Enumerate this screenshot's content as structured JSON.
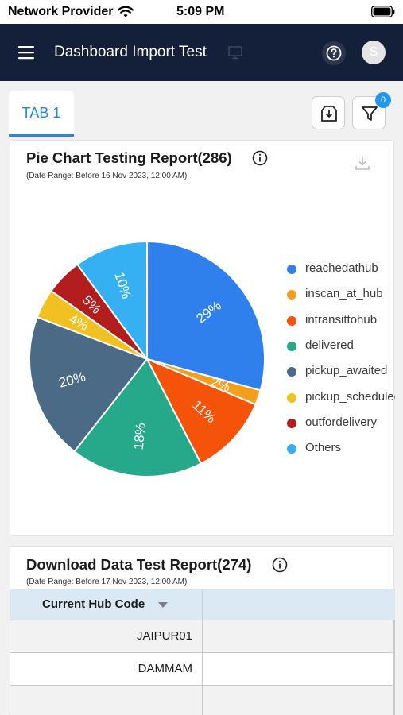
{
  "status_bar": {
    "carrier": "Network Provider",
    "time": "5:09 PM",
    "wifi_icon": "wifi-icon",
    "battery_icon": "battery-icon"
  },
  "app_bar": {
    "title": "Dashboard Import Test",
    "menu_icon": "hamburger-menu-icon",
    "screen_icon": "monitor-icon",
    "help_icon": "help-icon",
    "avatar_initial": "S",
    "background": "#141f3a"
  },
  "tabs": [
    {
      "label": "TAB 1",
      "active": true
    }
  ],
  "toolbar": {
    "download_icon": "download-tray-icon",
    "filter_icon": "filter-icon",
    "filter_badge": "0"
  },
  "pie_card": {
    "title": "Pie Chart Testing Report(286)",
    "date_range": "(Date Range: Before 16 Nov 2023, 12:00 AM)",
    "info_icon": "info-icon",
    "download_icon": "download-icon"
  },
  "chart_data": {
    "type": "pie",
    "title": "Pie Chart Testing Report(286)",
    "legend_position": "right",
    "slices": [
      {
        "label": "reachedathub",
        "value": 29,
        "display": "29%",
        "color": "#2f80ed"
      },
      {
        "label": "inscan_at_hub",
        "value": 2,
        "display": "2%",
        "color": "#f59e1b"
      },
      {
        "label": "intransittohub",
        "value": 11,
        "display": "11%",
        "color": "#f5520a"
      },
      {
        "label": "delivered",
        "value": 18,
        "display": "18%",
        "color": "#26a98a"
      },
      {
        "label": "pickup_awaited",
        "value": 20,
        "display": "20%",
        "color": "#4a6a86"
      },
      {
        "label": "pickup_scheduled",
        "value": 4,
        "display": "4%",
        "color": "#f1c021"
      },
      {
        "label": "outfordelivery",
        "value": 5,
        "display": "5%",
        "color": "#b41d1d"
      },
      {
        "label": "Others",
        "value": 10,
        "display": "10%",
        "color": "#35b0f3"
      }
    ]
  },
  "table_card": {
    "title": "Download Data Test Report(274)",
    "date_range": "(Date Range: Before 17 Nov 2023, 12:00 AM)",
    "info_icon": "info-icon",
    "columns": [
      {
        "label": "Current Hub Code",
        "sort_icon": "sort-down-icon"
      },
      {
        "label": ""
      }
    ],
    "rows": [
      [
        "JAIPUR01",
        ""
      ],
      [
        "DAMMAM",
        ""
      ],
      [
        "",
        ""
      ]
    ]
  }
}
